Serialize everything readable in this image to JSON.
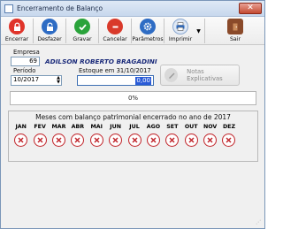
{
  "window": {
    "title": "Encerramento de Balanço"
  },
  "toolbar": {
    "items": [
      {
        "label": "Encerrar",
        "icon": "lock-icon",
        "color": "#e0342a"
      },
      {
        "label": "Desfazer",
        "icon": "unlock-icon",
        "color": "#2e6cc4"
      },
      {
        "label": "Gravar",
        "icon": "check-icon",
        "color": "#2aa33b"
      },
      {
        "label": "Cancelar",
        "icon": "cancel-icon",
        "color": "#d93a2b"
      },
      {
        "label": "Parâmetros",
        "icon": "gear-icon",
        "color": "#2e6cc4"
      },
      {
        "label": "Imprimir",
        "icon": "printer-icon",
        "color": "#2e6cc4"
      },
      {
        "label": "Sair",
        "icon": "exit-door-icon",
        "color": "#8a4a2a"
      }
    ]
  },
  "form": {
    "empresa_label": "Empresa",
    "empresa_code": "69",
    "empresa_name": "ADILSON ROBERTO BRAGADINI",
    "periodo_label": "Período",
    "periodo_value": "10/2017",
    "estoque_label": "Estoque em 31/10/2017",
    "estoque_value": "0,00",
    "notas_label": "Notas Explicativas"
  },
  "progress": {
    "text": "0%",
    "value": 0
  },
  "months_group": {
    "title": "Meses com balanço patrimonial encerrado no ano de 2017",
    "months": [
      "JAN",
      "FEV",
      "MAR",
      "ABR",
      "MAI",
      "JUN",
      "JUL",
      "AGO",
      "SET",
      "OUT",
      "NOV",
      "DEZ"
    ],
    "status_icon": "red-x-icon"
  }
}
